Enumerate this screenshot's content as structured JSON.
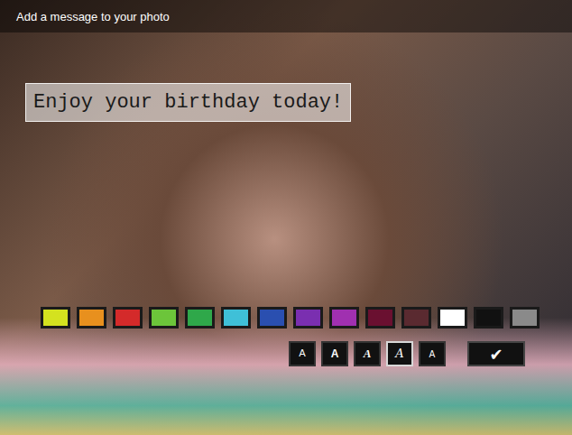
{
  "header": {
    "title": "Add a message to your photo"
  },
  "message": {
    "text": "Enjoy your birthday today!"
  },
  "colors": [
    {
      "color": "#d4e21f"
    },
    {
      "color": "#e8901e"
    },
    {
      "color": "#d42a2a"
    },
    {
      "color": "#6cc53a"
    },
    {
      "color": "#2fa84a"
    },
    {
      "color": "#3fc0d8"
    },
    {
      "color": "#2a4fb0"
    },
    {
      "color": "#7a2fb0"
    },
    {
      "color": "#a030b0"
    },
    {
      "color": "#6a1030"
    },
    {
      "color": "#5a2a30"
    },
    {
      "color": "#ffffff"
    },
    {
      "color": "#111111"
    },
    {
      "color": "#8a8a8a"
    }
  ],
  "fonts": [
    {
      "label": "A",
      "kind": "plain",
      "selected": false
    },
    {
      "label": "A",
      "kind": "bold",
      "selected": false
    },
    {
      "label": "A",
      "kind": "italic",
      "selected": false
    },
    {
      "label": "A",
      "kind": "script",
      "selected": true
    },
    {
      "label": "A",
      "kind": "small",
      "selected": false
    }
  ],
  "confirm": {
    "label": "✔"
  }
}
